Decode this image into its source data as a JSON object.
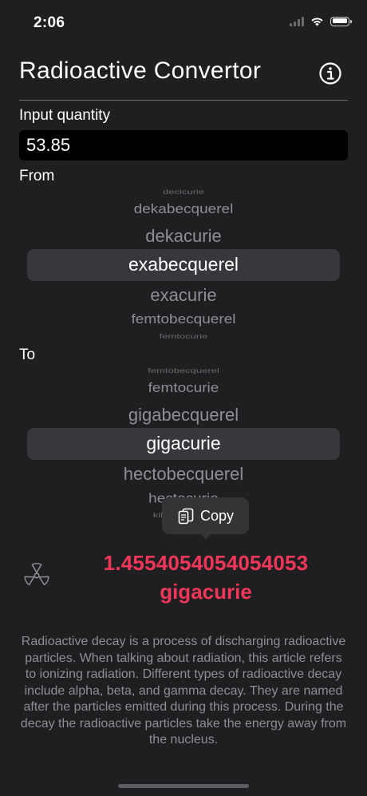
{
  "status_bar": {
    "time": "2:06"
  },
  "header": {
    "title": "Radioactive Convertor",
    "info_icon": "info-circle-icon"
  },
  "input": {
    "label": "Input quantity",
    "value": "53.85"
  },
  "from": {
    "label": "From",
    "options": [
      "decicurie",
      "dekabecquerel",
      "dekacurie",
      "exabecquerel",
      "exacurie",
      "femtobecquerel",
      "femtocurie"
    ],
    "selected": "exabecquerel"
  },
  "to": {
    "label": "To",
    "options": [
      "femtobecquerel",
      "femtocurie",
      "gigabecquerel",
      "gigacurie",
      "hectobecquerel",
      "hectocurie",
      "kilobecquerel"
    ],
    "selected": "gigacurie"
  },
  "copy_tooltip": {
    "label": "Copy",
    "icon": "copy-icon"
  },
  "result": {
    "icon": "radiation-icon",
    "value": "1.4554054054054053",
    "unit": "gigacurie"
  },
  "description": "Radioactive decay is a process of discharging radioactive particles. When talking about radiation, this article refers to ionizing radiation. Different types of radioactive decay include alpha, beta, and gamma decay. They are named after the particles emitted during this process. During the decay the radioactive particles take the energy away from the nucleus.",
  "colors": {
    "background": "#1f1f21",
    "accent": "#f2365a",
    "secondary_text": "#8e8e93",
    "input_background": "#000000"
  }
}
